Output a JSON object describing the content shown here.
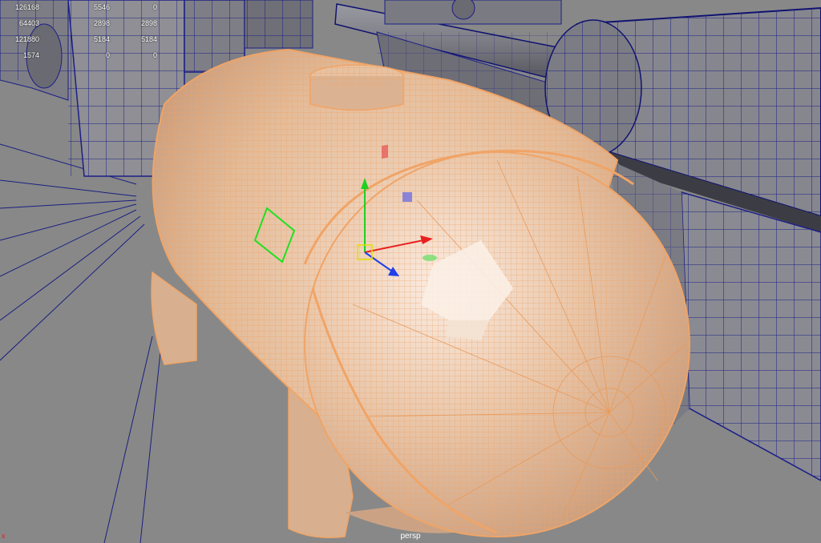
{
  "hud": {
    "rows": [
      [
        "126168",
        "5546",
        "0"
      ],
      [
        "64403",
        "2898",
        "2898"
      ],
      [
        "121880",
        "5184",
        "5184"
      ],
      [
        "1574",
        "0",
        "0"
      ]
    ]
  },
  "viewport": {
    "camera": "persp",
    "axis_indicator": "x"
  },
  "colors": {
    "background": "#888888",
    "selected_wire": "#f2a35e",
    "selected_shade": "#e8c3a2",
    "unselected_wire": "#161a7e",
    "unselected_shade": "#7a7a80",
    "manip_x": "#e82020",
    "manip_y": "#20d020",
    "manip_z": "#2040e8",
    "manip_center": "#e0e000"
  }
}
